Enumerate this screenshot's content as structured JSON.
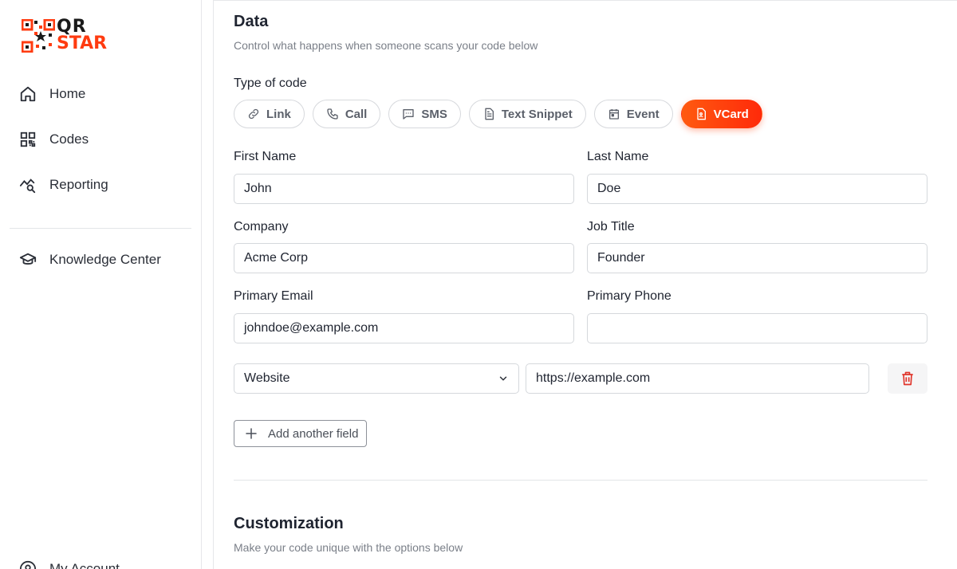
{
  "brand": {
    "line1": "QR",
    "line2": "STAR",
    "accent": "#ff3b10"
  },
  "sidebar": {
    "items": [
      {
        "label": "Home",
        "icon": "home-icon"
      },
      {
        "label": "Codes",
        "icon": "qr-code-icon"
      },
      {
        "label": "Reporting",
        "icon": "chart-search-icon"
      },
      {
        "label": "Knowledge Center",
        "icon": "graduation-cap-icon"
      }
    ],
    "bottom_item": {
      "label": "My Account",
      "icon": "user-circle-icon"
    }
  },
  "data_section": {
    "title": "Data",
    "subtitle": "Control what happens when someone scans your code below",
    "type_label": "Type of code",
    "types": [
      {
        "label": "Link",
        "icon": "link-icon",
        "active": false
      },
      {
        "label": "Call",
        "icon": "phone-icon",
        "active": false
      },
      {
        "label": "SMS",
        "icon": "message-icon",
        "active": false
      },
      {
        "label": "Text Snippet",
        "icon": "document-icon",
        "active": false
      },
      {
        "label": "Event",
        "icon": "calendar-icon",
        "active": false
      },
      {
        "label": "VCard",
        "icon": "vcard-icon",
        "active": true
      }
    ],
    "fields": {
      "first_name": {
        "label": "First Name",
        "value": "John"
      },
      "last_name": {
        "label": "Last Name",
        "value": "Doe"
      },
      "company": {
        "label": "Company",
        "value": "Acme Corp"
      },
      "job_title": {
        "label": "Job Title",
        "value": "Founder"
      },
      "primary_email": {
        "label": "Primary Email",
        "value": "johndoe@example.com"
      },
      "primary_phone": {
        "label": "Primary Phone",
        "value": ""
      }
    },
    "extra_field": {
      "type": "Website",
      "value": "https://example.com"
    },
    "add_field_label": "Add another field"
  },
  "customization": {
    "title": "Customization",
    "subtitle": "Make your code unique with the options below"
  },
  "colors": {
    "active_pill": "#ff4a0f",
    "delete": "#e0342a"
  }
}
